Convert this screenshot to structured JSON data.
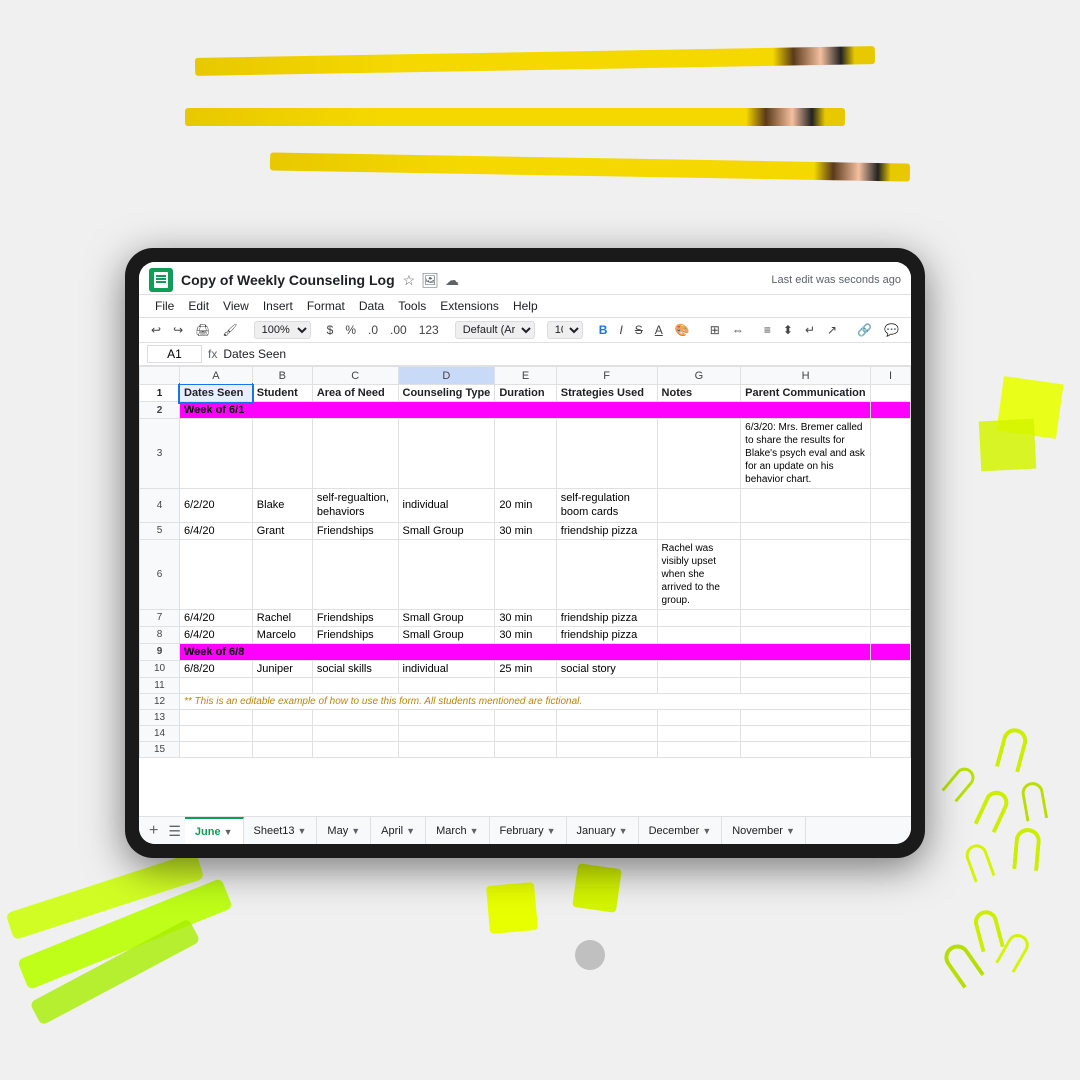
{
  "meta": {
    "bg_color": "#efefef"
  },
  "title_bar": {
    "doc_title": "Copy of Weekly Counseling Log",
    "last_edit": "Last edit was seconds ago"
  },
  "menu": {
    "items": [
      "File",
      "Edit",
      "View",
      "Insert",
      "Format",
      "Data",
      "Tools",
      "Extensions",
      "Help"
    ]
  },
  "toolbar": {
    "zoom": "100%",
    "currency_symbol": "$",
    "percent": "%",
    "decimal_0": ".0",
    "decimal_00": ".00",
    "format_123": "123",
    "font": "Default (Ari...",
    "font_size": "10",
    "bold": "B",
    "italic": "I",
    "strikethrough": "S"
  },
  "formula_bar": {
    "cell_ref": "A1",
    "formula_icon": "fx",
    "content": "Dates Seen"
  },
  "columns": {
    "letters": [
      "",
      "A",
      "B",
      "C",
      "D",
      "E",
      "F",
      "G",
      "H",
      "I"
    ],
    "headers": [
      "Dates Seen",
      "Student",
      "Area of Need",
      "Counseling Type",
      "Duration",
      "Strategies Used",
      "Notes",
      "Parent Communication"
    ]
  },
  "rows": [
    {
      "type": "week_header",
      "label": "Week of 6/1",
      "span": 8
    },
    {
      "type": "data",
      "date": "",
      "student": "",
      "area": "",
      "type_": "",
      "duration": "",
      "strategies": "",
      "notes": "",
      "parent": "6/3/20: Mrs. Bremer called to share the results for Blake's psych eval and ask for an update on his behavior chart."
    },
    {
      "type": "data",
      "date": "6/2/20",
      "student": "Blake",
      "area": "self-regualtion, behaviors",
      "type_": "individual",
      "duration": "20 min",
      "strategies": "self-regulation boom cards",
      "notes": "",
      "parent": ""
    },
    {
      "type": "data",
      "date": "6/4/20",
      "student": "Grant",
      "area": "Friendships",
      "type_": "Small Group",
      "duration": "30 min",
      "strategies": "friendship pizza",
      "notes": "",
      "parent": ""
    },
    {
      "type": "data",
      "date": "",
      "student": "",
      "area": "",
      "type_": "",
      "duration": "",
      "strategies": "",
      "notes": "Rachel was visibly upset when she arrived to the group.",
      "parent": ""
    },
    {
      "type": "data",
      "date": "6/4/20",
      "student": "Rachel",
      "area": "Friendships",
      "type_": "Small Group",
      "duration": "30 min",
      "strategies": "friendship pizza",
      "notes": "",
      "parent": ""
    },
    {
      "type": "data",
      "date": "6/4/20",
      "student": "Marcelo",
      "area": "Friendships",
      "type_": "Small Group",
      "duration": "30 min",
      "strategies": "friendship pizza",
      "notes": "",
      "parent": ""
    },
    {
      "type": "week_header",
      "label": "Week of 6/8",
      "span": 8
    },
    {
      "type": "data",
      "date": "6/8/20",
      "student": "Juniper",
      "area": "social skills",
      "type_": "individual",
      "duration": "25 min",
      "strategies": "social story",
      "notes": "",
      "parent": ""
    },
    {
      "type": "data",
      "date": "",
      "student": "",
      "area": "",
      "type_": "",
      "duration": "",
      "strategies": "",
      "notes": "",
      "parent": ""
    },
    {
      "type": "note",
      "text": "** This is an editable example of how to use this form. All students mentioned are fictional.",
      "span": 8
    }
  ],
  "tabs": [
    {
      "label": "June",
      "active": true
    },
    {
      "label": "Sheet13",
      "active": false
    },
    {
      "label": "May",
      "active": false
    },
    {
      "label": "April",
      "active": false
    },
    {
      "label": "March",
      "active": false
    },
    {
      "label": "February",
      "active": false
    },
    {
      "label": "January",
      "active": false
    },
    {
      "label": "December",
      "active": false
    },
    {
      "label": "November",
      "active": false
    }
  ]
}
